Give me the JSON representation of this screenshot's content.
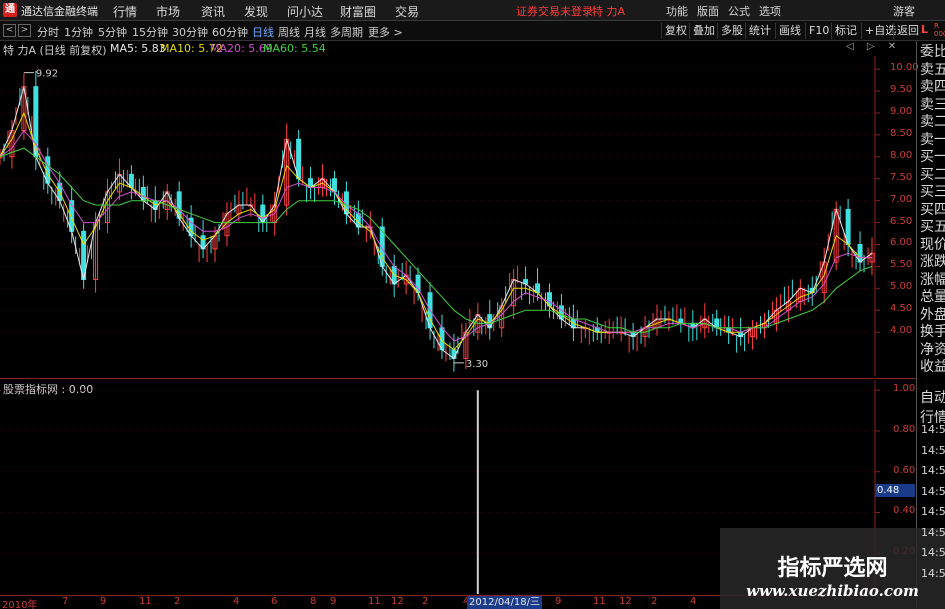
{
  "app": {
    "title": "通达信金融终端",
    "logo": "通"
  },
  "menu": [
    "行情",
    "市场",
    "资讯",
    "发现",
    "问小达",
    "财富圈",
    "交易"
  ],
  "broker_status": "证券交易未登录",
  "stock_name": "特 力A",
  "right_menu": [
    "功能",
    "版面",
    "公式",
    "选项"
  ],
  "guest_label": "游客",
  "nav_buttons": [
    "<",
    ">"
  ],
  "periods": [
    "分时",
    "1分钟",
    "5分钟",
    "15分钟",
    "30分钟",
    "60分钟",
    "日线",
    "周线",
    "月线",
    "多周期",
    "更多 >"
  ],
  "active_period": "日线",
  "tools": [
    "复权",
    "叠加",
    "多股",
    "统计",
    "画线",
    "F10",
    "标记",
    "+自选",
    "返回"
  ],
  "corner": {
    "L": "L",
    "R": "R\n000"
  },
  "info": {
    "title": "特 力A (日线 前复权)",
    "ma": [
      {
        "label": "MA5: 5.83",
        "color": "#e8e8e8"
      },
      {
        "label": "MA10: 5.72",
        "color": "#e8d800"
      },
      {
        "label": "MA20: 5.69",
        "color": "#d050d0"
      },
      {
        "label": "MA60: 5.54",
        "color": "#40d040"
      }
    ],
    "controls": "◁ ▷ ✕"
  },
  "orderbook": [
    "委比",
    "卖五",
    "卖四",
    "卖三",
    "卖二",
    "卖一",
    "买一",
    "买二",
    "买三",
    "买四",
    "买五",
    "现价",
    "涨跌",
    "涨幅",
    "总量",
    "外盘",
    "换手",
    "净资",
    "收益"
  ],
  "auto_panel": {
    "labels": [
      "自动",
      "行情"
    ],
    "times": [
      "14:50",
      "14:50",
      "14:50",
      "14:56",
      "14:56",
      "14:56",
      "14:56",
      "14:56"
    ]
  },
  "sub_chart": {
    "title": "股票指标网 : 0.00",
    "marker": "0.48"
  },
  "x_axis": {
    "ticks": [
      "2010年",
      "7",
      "9",
      "11",
      "2",
      "4",
      "6",
      "8",
      "9",
      "11",
      "12",
      "2",
      "4",
      "8",
      "9",
      "11",
      "12",
      "2",
      "4"
    ],
    "cursor_date": "2012/04/18/三"
  },
  "watermark": {
    "title": "指标严选网",
    "url": "www.xuezhibiao.com"
  },
  "colors": {
    "up": "#ff4040",
    "down": "#40e0e0",
    "axis": "#cc3b3b",
    "grid": "#3a0f0f",
    "accent": "#1a3b8a"
  },
  "chart_data": [
    {
      "type": "line",
      "title": "特 力A (日线 前复权)",
      "ylim": [
        3.0,
        10.3
      ],
      "y_ticks": [
        "10.00",
        "9.50",
        "9.00",
        "8.50",
        "8.00",
        "7.50",
        "7.00",
        "6.50",
        "6.00",
        "5.50",
        "5.00",
        "4.50",
        "4.00"
      ],
      "annotations": [
        {
          "label": "9.92",
          "value": 9.92
        },
        {
          "label": "3.30",
          "value": 3.3
        }
      ],
      "series": [
        {
          "name": "MA5",
          "color": "#e8e8e8",
          "values": [
            8.0,
            8.6,
            9.6,
            8.0,
            7.4,
            7.0,
            6.3,
            5.2,
            6.5,
            7.2,
            7.6,
            7.3,
            7.0,
            6.8,
            7.2,
            6.6,
            6.2,
            5.9,
            6.2,
            6.7,
            6.9,
            6.9,
            6.5,
            6.9,
            8.4,
            7.5,
            7.3,
            7.5,
            7.2,
            6.7,
            6.4,
            6.4,
            5.5,
            5.1,
            5.3,
            4.9,
            4.1,
            3.6,
            3.4,
            4.0,
            4.4,
            4.1,
            4.6,
            5.2,
            5.1,
            4.9,
            4.6,
            4.3,
            4.1,
            4.1,
            4.0,
            4.0,
            4.0,
            3.9,
            4.1,
            4.3,
            4.3,
            4.2,
            4.1,
            4.3,
            4.1,
            4.0,
            3.9,
            4.1,
            4.2,
            4.5,
            4.7,
            5.0,
            4.9,
            5.6,
            6.8,
            6.0,
            5.6,
            5.8
          ]
        },
        {
          "name": "MA10",
          "color": "#e8d800",
          "values": [
            8.0,
            8.4,
            9.0,
            8.2,
            7.6,
            7.2,
            6.6,
            6.0,
            6.4,
            7.0,
            7.4,
            7.3,
            7.1,
            6.9,
            7.0,
            6.7,
            6.3,
            6.1,
            6.2,
            6.5,
            6.7,
            6.8,
            6.6,
            6.8,
            7.8,
            7.5,
            7.3,
            7.4,
            7.2,
            6.8,
            6.5,
            6.3,
            5.7,
            5.3,
            5.2,
            4.9,
            4.3,
            3.8,
            3.6,
            3.9,
            4.3,
            4.2,
            4.5,
            5.0,
            5.0,
            4.9,
            4.6,
            4.4,
            4.2,
            4.1,
            4.0,
            4.0,
            4.0,
            4.0,
            4.1,
            4.2,
            4.3,
            4.2,
            4.1,
            4.2,
            4.1,
            4.0,
            4.0,
            4.1,
            4.2,
            4.4,
            4.6,
            4.8,
            4.9,
            5.3,
            6.2,
            6.0,
            5.7,
            5.7
          ]
        },
        {
          "name": "MA20",
          "color": "#d050d0",
          "values": [
            8.0,
            8.2,
            8.6,
            8.3,
            7.8,
            7.4,
            6.9,
            6.5,
            6.5,
            6.8,
            7.1,
            7.2,
            7.1,
            7.0,
            7.0,
            6.8,
            6.5,
            6.3,
            6.3,
            6.4,
            6.6,
            6.7,
            6.6,
            6.7,
            7.3,
            7.4,
            7.3,
            7.3,
            7.2,
            6.9,
            6.7,
            6.4,
            5.9,
            5.5,
            5.3,
            5.0,
            4.5,
            4.1,
            3.8,
            3.9,
            4.1,
            4.2,
            4.4,
            4.7,
            4.9,
            4.8,
            4.7,
            4.5,
            4.3,
            4.2,
            4.1,
            4.0,
            4.0,
            4.0,
            4.1,
            4.1,
            4.2,
            4.2,
            4.1,
            4.2,
            4.1,
            4.1,
            4.0,
            4.1,
            4.1,
            4.3,
            4.5,
            4.7,
            4.8,
            5.1,
            5.7,
            5.8,
            5.7,
            5.7
          ]
        },
        {
          "name": "MA60",
          "color": "#40d040",
          "values": [
            8.0,
            8.1,
            8.2,
            8.0,
            7.8,
            7.6,
            7.3,
            7.0,
            6.9,
            6.9,
            6.9,
            7.0,
            7.0,
            7.0,
            6.9,
            6.8,
            6.7,
            6.6,
            6.5,
            6.5,
            6.5,
            6.5,
            6.5,
            6.5,
            6.8,
            7.0,
            7.0,
            7.0,
            7.0,
            6.9,
            6.8,
            6.6,
            6.3,
            6.0,
            5.7,
            5.4,
            5.1,
            4.8,
            4.5,
            4.3,
            4.2,
            4.2,
            4.3,
            4.4,
            4.5,
            4.5,
            4.5,
            4.4,
            4.3,
            4.3,
            4.2,
            4.1,
            4.1,
            4.0,
            4.0,
            4.1,
            4.1,
            4.2,
            4.2,
            4.2,
            4.1,
            4.1,
            4.1,
            4.1,
            4.1,
            4.2,
            4.3,
            4.4,
            4.5,
            4.7,
            5.0,
            5.2,
            5.4,
            5.5
          ]
        }
      ]
    },
    {
      "type": "bar",
      "title": "股票指标网 : 0.00",
      "ylim": [
        0,
        1.05
      ],
      "y_ticks": [
        "1.00",
        "0.80",
        "0.60",
        "0.40",
        "0.20"
      ],
      "spike_index": 40,
      "spike_value": 1.0,
      "count": 74
    }
  ]
}
